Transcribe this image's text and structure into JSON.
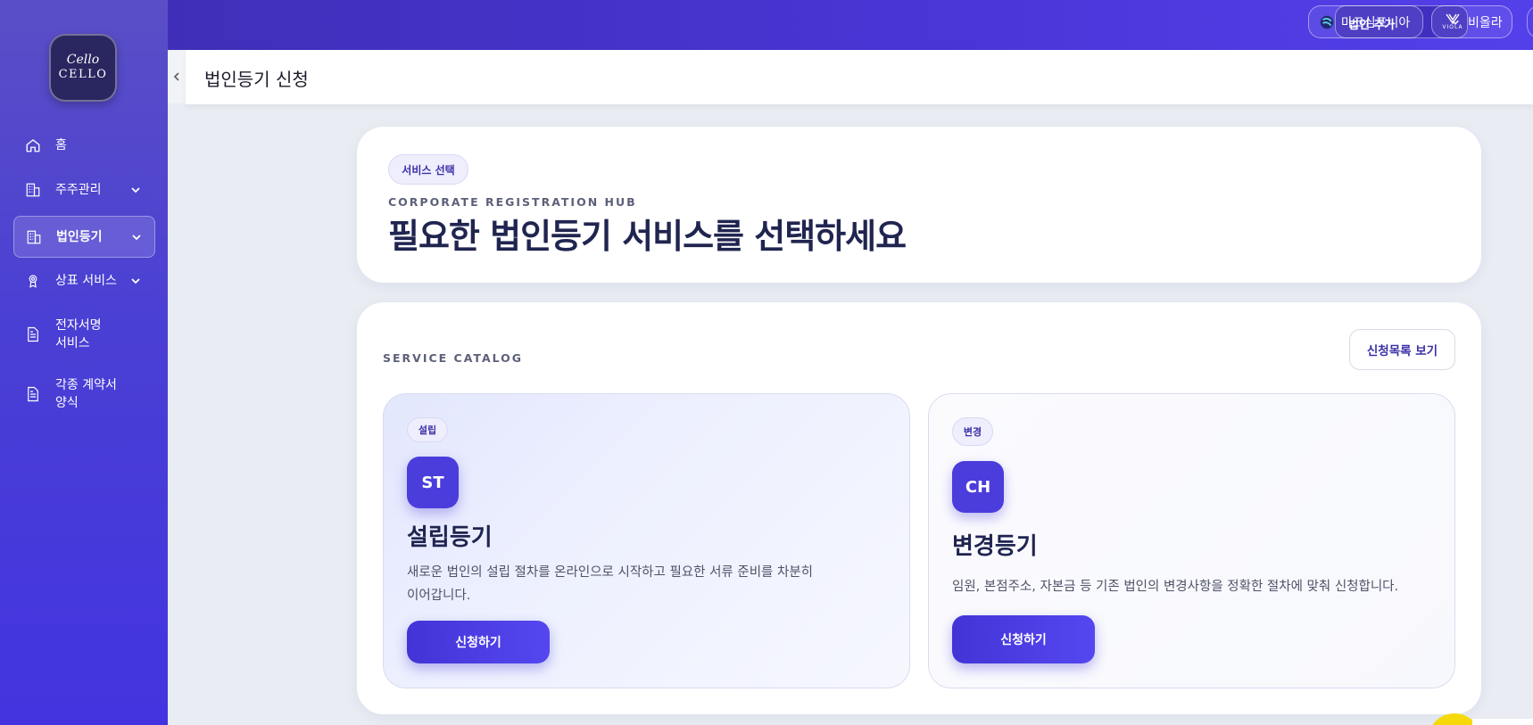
{
  "brand": {
    "script": "Cello",
    "word": "CELLO"
  },
  "sidebar": {
    "items": [
      {
        "label": "홈",
        "icon": "home-icon"
      },
      {
        "label": "주주관리",
        "icon": "building-icon"
      },
      {
        "label": "법인등기",
        "icon": "building-icon"
      },
      {
        "label": "상표 서비스",
        "icon": "award-icon"
      },
      {
        "label": "전자서명\n서비스",
        "icon": "document-icon"
      },
      {
        "label": "각종 계약서\n양식",
        "icon": "document-icon"
      }
    ]
  },
  "topbar": {
    "company_select": "법인 추가",
    "chips": [
      {
        "label": "마크심포니아",
        "icon": "marksymphonia-logo-icon"
      },
      {
        "label": "비올라",
        "icon": "viola-logo-icon",
        "sub": "VIOLA"
      }
    ]
  },
  "page": {
    "title": "법인등기 신청"
  },
  "hero": {
    "pill": "서비스 선택",
    "eyebrow": "CORPORATE REGISTRATION HUB",
    "headline": "필요한 법인등기 서비스를 선택하세요"
  },
  "catalog": {
    "eyebrow": "SERVICE CATALOG",
    "list_button": "신청목록 보기",
    "services": [
      {
        "tag": "설립",
        "badge": "ST",
        "title": "설립등기",
        "desc_line1": "새로운 법인의 설립 절차를 온라인으로 시작하고 필요한 서류 준비를 차분히",
        "desc_line2": "이어갑니다.",
        "cta": "신청하기"
      },
      {
        "tag": "변경",
        "badge": "CH",
        "title": "변경등기",
        "desc_line1": "임원, 본점주소, 자본금 등 기존 법인의 변경사항을 정확한 절차에 맞춰 신청합니다.",
        "cta": "신청하기"
      }
    ]
  }
}
